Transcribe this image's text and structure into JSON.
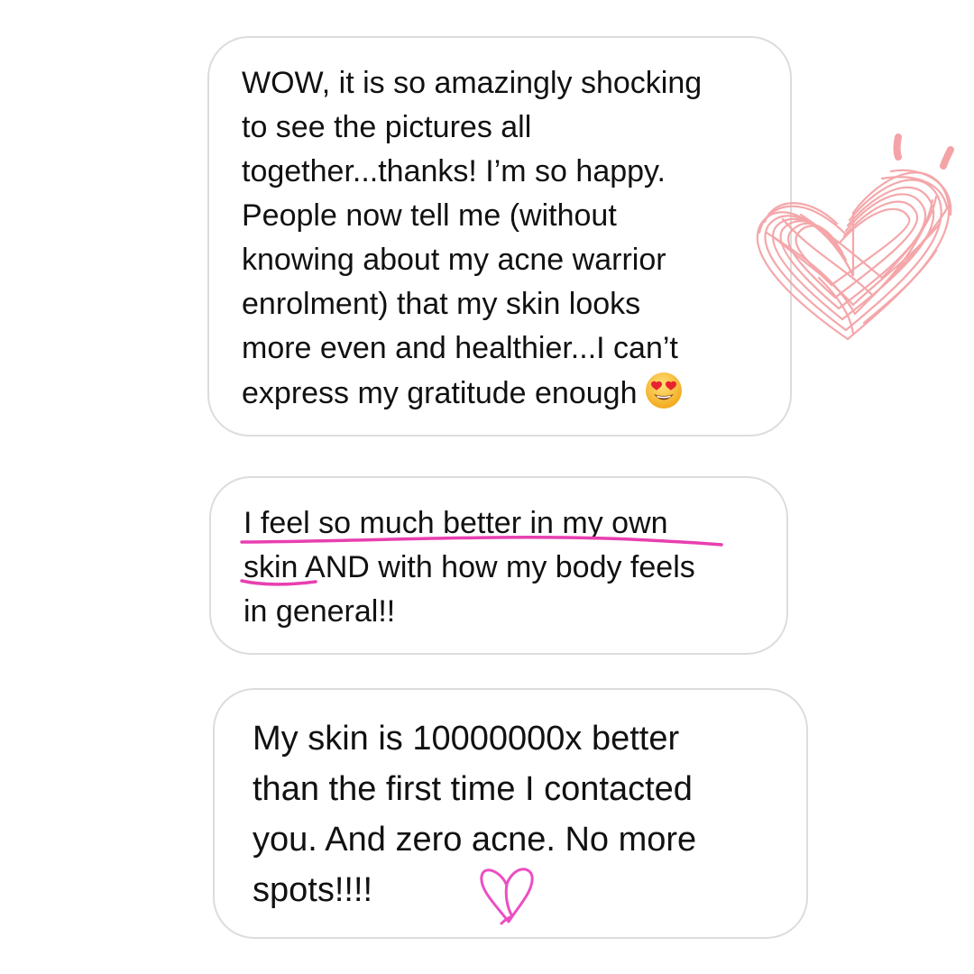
{
  "messages": [
    {
      "text": "WOW, it is so amazingly shocking\nto see the pictures all\ntogether...thanks! I’m so happy.\nPeople now tell me (without\nknowing about my acne warrior\nenrolment) that my skin looks\nmore even and healthier...I can’t\nexpress my gratitude enough",
      "emoji": "heart-eyes-emoji-icon"
    },
    {
      "text": "I feel so much better in my own\nskin AND with how my body feels\nin general!!"
    },
    {
      "text": "My skin is 10000000x better\nthan the first time I contacted\nyou. And zero acne. No more\nspots!!!!"
    }
  ],
  "decorations": {
    "underline_color": "#e83fb0",
    "big_heart_color": "#f4a3a6",
    "small_heart_color": "#ec4ec2",
    "emoji_face_color": "#f7c23a",
    "emoji_heart_color": "#e8232f"
  }
}
